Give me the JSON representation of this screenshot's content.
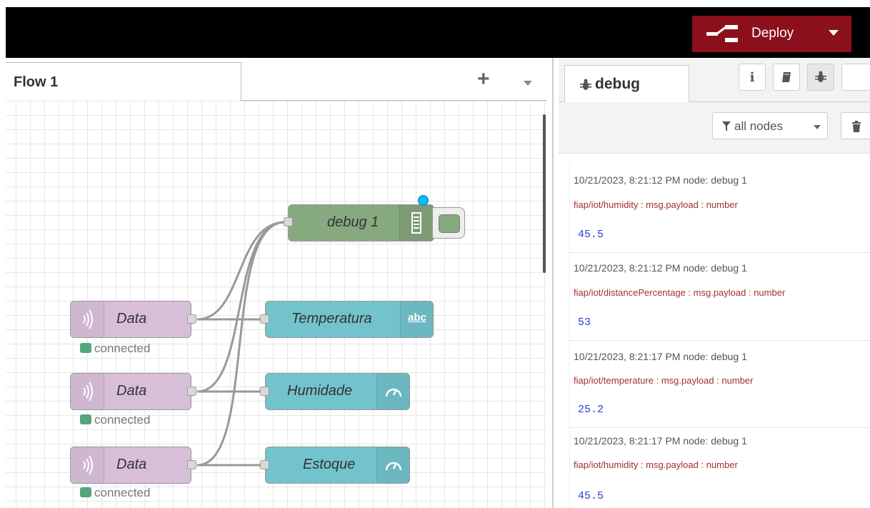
{
  "header": {
    "deploy_label": "Deploy"
  },
  "workspace": {
    "flow_tab": "Flow 1",
    "nodes": {
      "debug": {
        "label": "debug 1"
      },
      "mqtt_in": [
        {
          "label": "Data",
          "status": "connected"
        },
        {
          "label": "Data",
          "status": "connected"
        },
        {
          "label": "Data",
          "status": "connected"
        }
      ],
      "text_node": {
        "label": "Temperatura",
        "badge": "abc"
      },
      "gauge_nodes": [
        {
          "label": "Humidade"
        },
        {
          "label": "Estoque"
        }
      ]
    }
  },
  "sidebar": {
    "active_tab": "debug",
    "tab_icons": [
      "info-icon",
      "book-icon",
      "bug-icon"
    ],
    "filter_label": "all nodes",
    "messages": [
      {
        "meta": "10/21/2023, 8:21:12 PM   node: debug 1",
        "topic": "fiap/iot/humidity : msg.payload : number",
        "value": "45.5"
      },
      {
        "meta": "10/21/2023, 8:21:12 PM   node: debug 1",
        "topic": "fiap/iot/distancePercentage : msg.payload : number",
        "value": "53"
      },
      {
        "meta": "10/21/2023, 8:21:17 PM   node: debug 1",
        "topic": "fiap/iot/temperature : msg.payload : number",
        "value": "25.2"
      },
      {
        "meta": "10/21/2023, 8:21:17 PM   node: debug 1",
        "topic": "fiap/iot/humidity : msg.payload : number",
        "value": "45.5"
      }
    ]
  },
  "colors": {
    "deploy": "#8c101c",
    "mqtt_node": "#d8bfd8",
    "dashboard_node": "#73c3cd",
    "debug_node": "#87a980",
    "status_connected": "#55a57c",
    "topic_text": "#a23030",
    "value_text": "#2b3fd4"
  }
}
